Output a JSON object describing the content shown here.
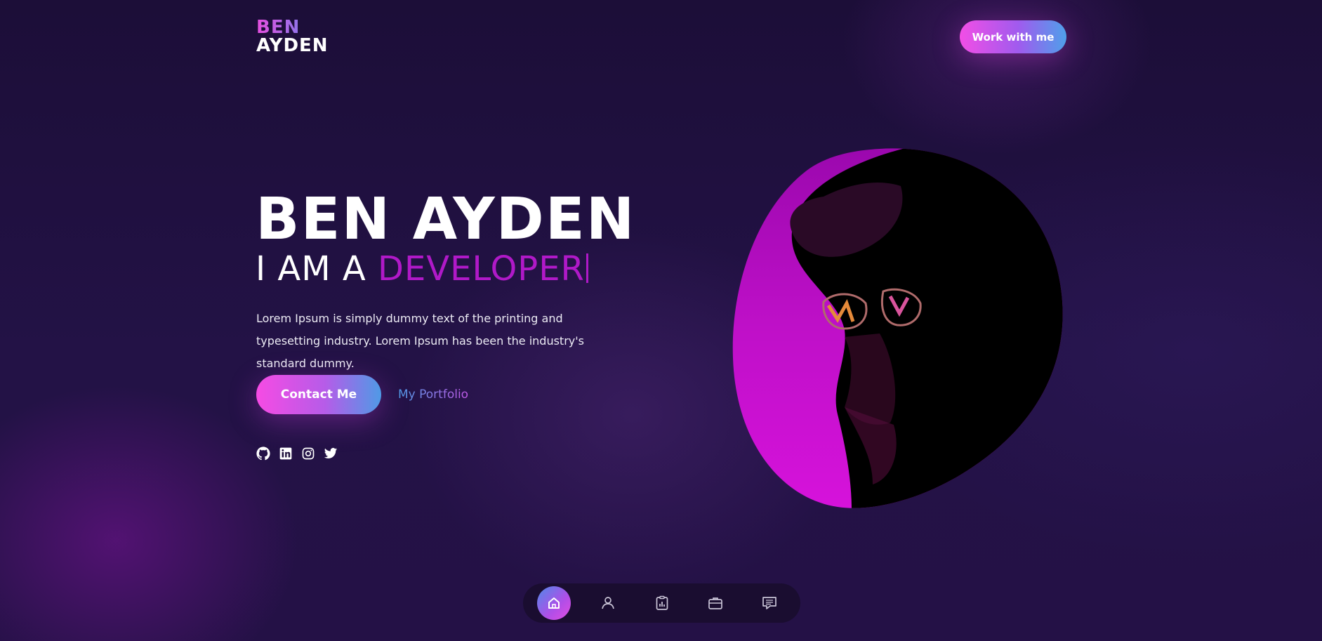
{
  "header": {
    "logo_line1": "BEN",
    "logo_line2": "AYDEN",
    "cta_label": "Work with me"
  },
  "hero": {
    "name": "BEN AYDEN",
    "sub_prefix": "I AM A ",
    "role": "DEVELOPER",
    "description": "Lorem Ipsum is simply dummy text of the printing and typesetting industry. Lorem Ipsum has been the industry's standard dummy.",
    "primary_button": "Contact Me",
    "secondary_link": "My Portfolio"
  },
  "socials": [
    {
      "icon": "github-icon"
    },
    {
      "icon": "linkedin-icon"
    },
    {
      "icon": "instagram-icon"
    },
    {
      "icon": "twitter-icon"
    }
  ],
  "bottom_nav": {
    "items": [
      {
        "icon": "home-icon",
        "active": true
      },
      {
        "icon": "user-icon",
        "active": false
      },
      {
        "icon": "clipboard-chart-icon",
        "active": false
      },
      {
        "icon": "briefcase-icon",
        "active": false
      },
      {
        "icon": "message-icon",
        "active": false
      }
    ]
  },
  "colors": {
    "background": "#1d0f3a",
    "accent_pink": "#f24ee6",
    "accent_blue": "#4fa0ea",
    "role_text": "#b019c8"
  }
}
